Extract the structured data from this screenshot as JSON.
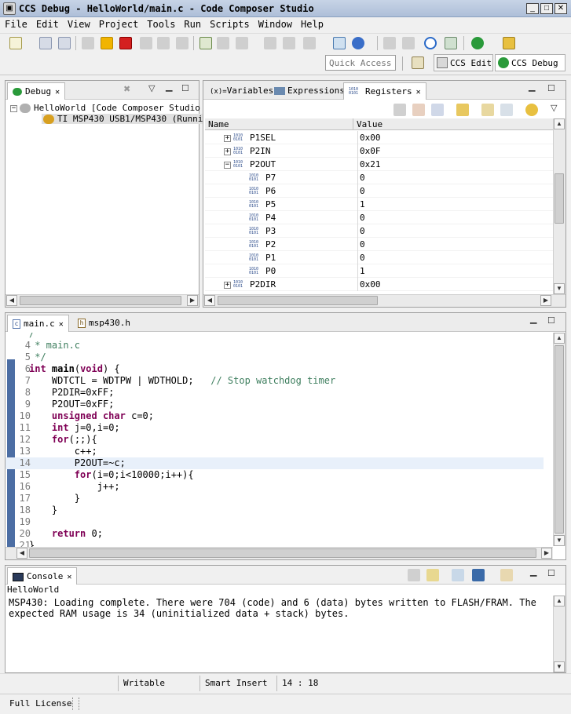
{
  "window": {
    "title": "CCS Debug - HelloWorld/main.c - Code Composer Studio",
    "icon": "ccs-app-icon"
  },
  "menu": [
    "File",
    "Edit",
    "View",
    "Project",
    "Tools",
    "Run",
    "Scripts",
    "Window",
    "Help"
  ],
  "toolbar": {
    "quick_access_placeholder": "Quick Access",
    "perspectives": [
      {
        "label": "CCS Edit",
        "icon": "ccs-edit-icon"
      },
      {
        "label": "CCS Debug",
        "icon": "ccs-debug-icon"
      }
    ]
  },
  "debug_view": {
    "tab_label": "Debug",
    "tree": [
      {
        "label": "HelloWorld [Code Composer Studio -",
        "icon": "debug-session-icon"
      },
      {
        "label": "TI MSP430 USB1/MSP430 (Running,",
        "icon": "target-running-icon"
      }
    ]
  },
  "register_view": {
    "tabs": [
      {
        "label": "Variables",
        "prefix": "(x)="
      },
      {
        "label": "Expressions",
        "prefix": ""
      },
      {
        "label": "Registers",
        "prefix": "0101"
      }
    ],
    "columns": [
      "Name",
      "Value"
    ],
    "rows": [
      {
        "name": "P1SEL",
        "value": "0x00",
        "expander": "+"
      },
      {
        "name": "P2IN",
        "value": "0x0F",
        "expander": "+"
      },
      {
        "name": "P2OUT",
        "value": "0x21",
        "expander": "-"
      },
      {
        "name": "P7",
        "value": "0",
        "expander": ""
      },
      {
        "name": "P6",
        "value": "0",
        "expander": ""
      },
      {
        "name": "P5",
        "value": "1",
        "expander": ""
      },
      {
        "name": "P4",
        "value": "0",
        "expander": ""
      },
      {
        "name": "P3",
        "value": "0",
        "expander": ""
      },
      {
        "name": "P2",
        "value": "0",
        "expander": ""
      },
      {
        "name": "P1",
        "value": "0",
        "expander": ""
      },
      {
        "name": "P0",
        "value": "1",
        "expander": ""
      },
      {
        "name": "P2DIR",
        "value": "0x00",
        "expander": "+"
      }
    ]
  },
  "editor": {
    "tabs": [
      {
        "label": "main.c",
        "icon": "c-file-icon"
      },
      {
        "label": "msp430.h",
        "icon": "h-file-icon"
      }
    ],
    "lines": [
      {
        "n": "4",
        "text": " * main.c"
      },
      {
        "n": "5",
        "text": " */"
      },
      {
        "n": "6",
        "text": "int main(void) {"
      },
      {
        "n": "7",
        "text": "    WDTCTL = WDTPW | WDTHOLD;   // Stop watchdog timer"
      },
      {
        "n": "8",
        "text": "    P2DIR=0xFF;"
      },
      {
        "n": "9",
        "text": "    P2OUT=0xFF;"
      },
      {
        "n": "10",
        "text": "    unsigned char c=0;"
      },
      {
        "n": "11",
        "text": "    int j=0,i=0;"
      },
      {
        "n": "12",
        "text": "    for(;;){"
      },
      {
        "n": "13",
        "text": "        c++;"
      },
      {
        "n": "14",
        "text": "        P2OUT=~c;"
      },
      {
        "n": "15",
        "text": "        for(i=0;i<10000;i++){"
      },
      {
        "n": "16",
        "text": "            j++;"
      },
      {
        "n": "17",
        "text": "        }"
      },
      {
        "n": "18",
        "text": "    }"
      },
      {
        "n": "19",
        "text": ""
      },
      {
        "n": "20",
        "text": "    return 0;"
      },
      {
        "n": "21",
        "text": "}"
      }
    ]
  },
  "console": {
    "tab_label": "Console",
    "subtitle": "HelloWorld",
    "text": "MSP430: Loading complete. There were 704 (code) and 6 (data) bytes written to FLASH/FRAM. The\nexpected RAM usage is 34 (uninitialized data + stack) bytes."
  },
  "status": {
    "writable": "Writable",
    "insert_mode": "Smart Insert",
    "position": "14 : 18",
    "license": "Full License"
  }
}
